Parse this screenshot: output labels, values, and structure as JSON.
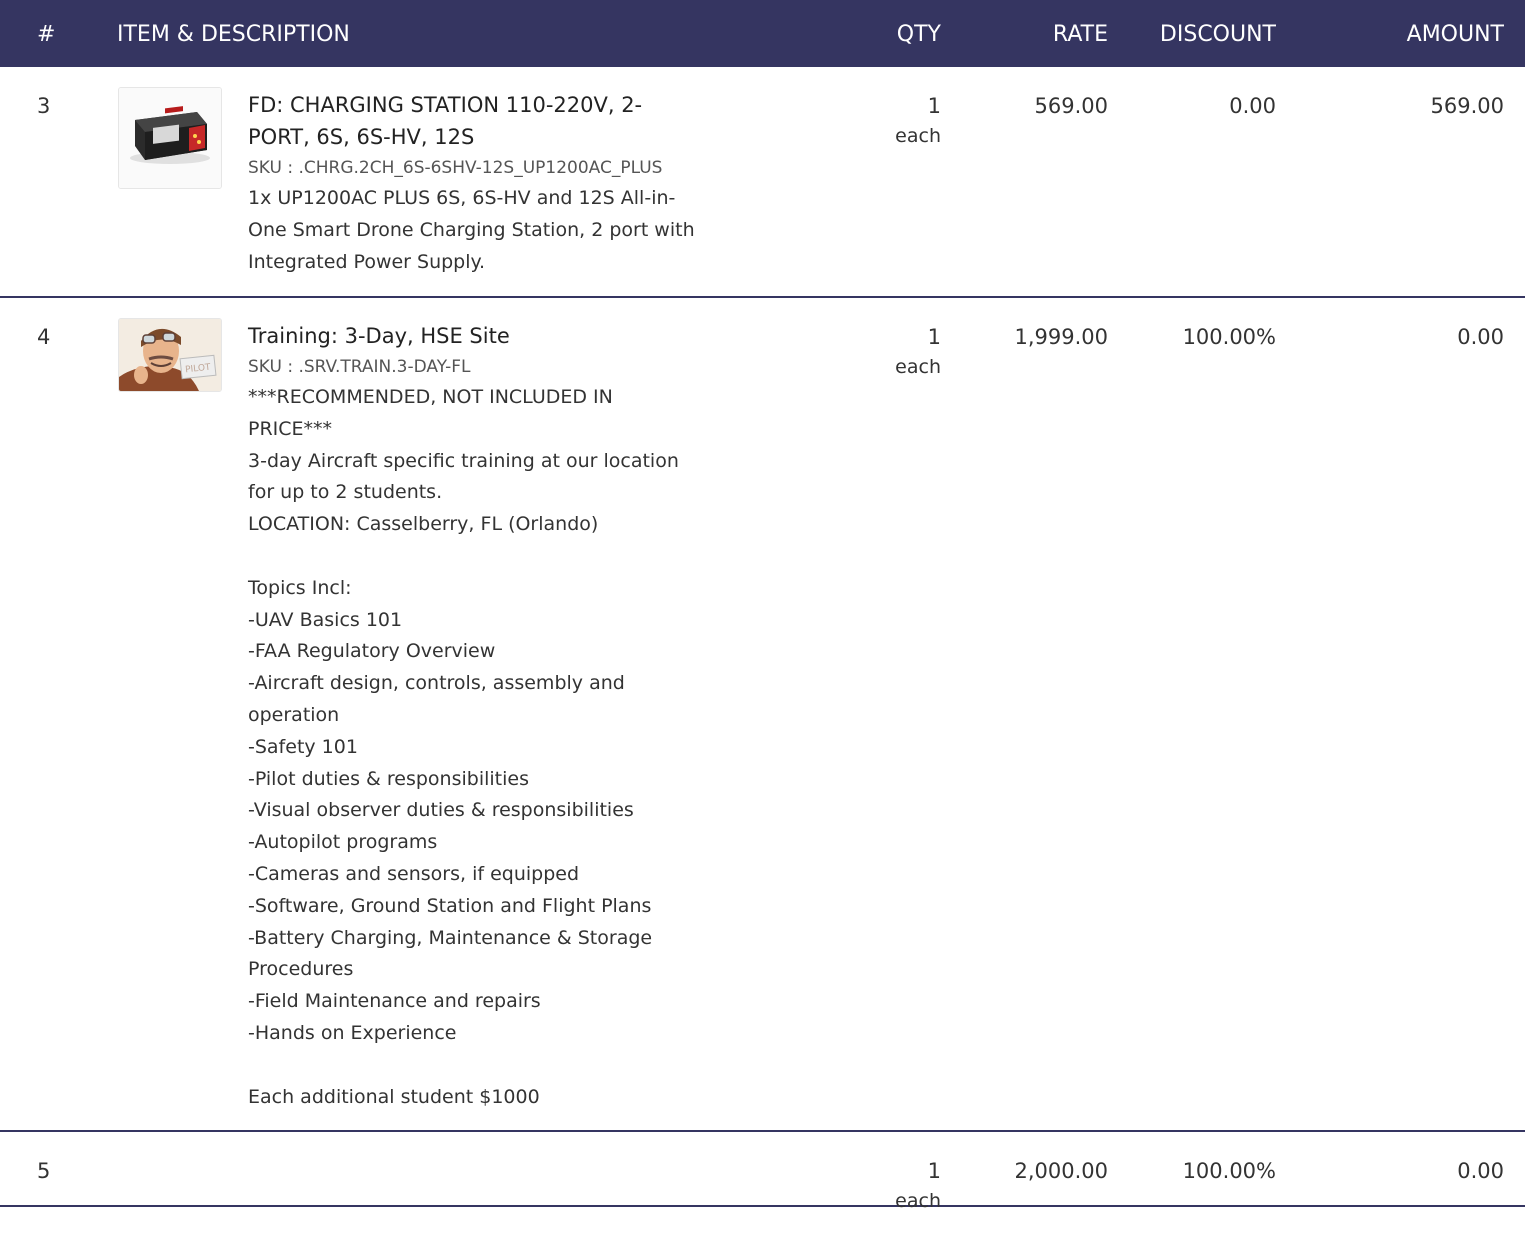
{
  "header": {
    "num": "#",
    "item": "ITEM & DESCRIPTION",
    "qty": "QTY",
    "rate": "RATE",
    "discount": "DISCOUNT",
    "amount": "AMOUNT"
  },
  "colors": {
    "header_bg": "#353561",
    "header_text": "#ffffff",
    "divider": "#353561"
  },
  "rows": [
    {
      "num": "3",
      "thumbnail_icon": "charger-product-image",
      "title": "FD: CHARGING STATION 110-220V, 2-\nPORT, 6S, 6S-HV, 12S",
      "sku": "SKU : .CHRG.2CH_6S-6SHV-12S_UP1200AC_PLUS",
      "description": "1x UP1200AC PLUS 6S, 6S-HV and 12S All-in-\nOne Smart Drone Charging Station, 2 port with\nIntegrated Power Supply.",
      "qty": "1",
      "unit": "each",
      "rate": "569.00",
      "discount": "0.00",
      "amount": "569.00"
    },
    {
      "num": "4",
      "thumbnail_icon": "pilot-product-image",
      "thumbnail_text": "PILOT",
      "title": "Training: 3-Day, HSE Site",
      "sku": "SKU : .SRV.TRAIN.3-DAY-FL",
      "description": "***RECOMMENDED, NOT INCLUDED IN\nPRICE***\n3-day Aircraft specific training at our location\nfor up to 2 students.\nLOCATION: Casselberry, FL (Orlando)\n\nTopics Incl:\n-UAV Basics 101\n-FAA Regulatory Overview\n-Aircraft design, controls, assembly and\noperation\n-Safety 101\n-Pilot duties & responsibilities\n-Visual observer duties & responsibilities\n-Autopilot programs\n-Cameras and sensors, if equipped\n-Software, Ground Station and Flight Plans\n-Battery Charging, Maintenance & Storage\nProcedures\n-Field Maintenance and repairs\n-Hands on Experience\n\nEach additional student $1000",
      "qty": "1",
      "unit": "each",
      "rate": "1,999.00",
      "discount": "100.00%",
      "amount": "0.00"
    },
    {
      "num": "5",
      "qty": "1",
      "unit": "each",
      "rate": "2,000.00",
      "discount": "100.00%",
      "amount": "0.00"
    }
  ]
}
